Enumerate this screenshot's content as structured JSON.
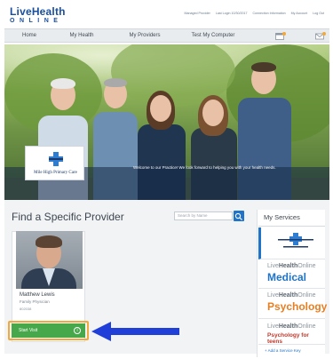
{
  "brand": {
    "line1_a": "Live",
    "line1_b": "Health",
    "line2": "ONLINE"
  },
  "utility_links": [
    "Managed Provider",
    "Last Login 10/30/2017",
    "Connection Information",
    "My Account",
    "Log Out"
  ],
  "nav": {
    "home": "Home",
    "my_health": "My Health",
    "my_providers": "My Providers",
    "test_computer": "Test My Computer"
  },
  "hero": {
    "clinic_name": "Mile High Primary Care",
    "welcome_text": "Welcome to our Practice! We look forward to helping you with your health needs."
  },
  "find_provider": {
    "title": "Find a Specific Provider",
    "search_placeholder": "Search by Name"
  },
  "provider": {
    "name": "Matthew Lewis",
    "role": "Family Physician",
    "id": "802038",
    "start_visit_label": "Start Visit"
  },
  "services": {
    "title": "My Services",
    "items": [
      {
        "brand_a": "Live",
        "brand_b": "Health",
        "brand_c": "Online",
        "name": "Medical",
        "color": "#1f73c8"
      },
      {
        "brand_a": "Live",
        "brand_b": "Health",
        "brand_c": "Online",
        "name": "Psychology",
        "color": "#e67e22"
      },
      {
        "brand_a": "Live",
        "brand_b": "Health",
        "brand_c": "Online",
        "name": "Psychology for teens",
        "color": "#c0392b"
      }
    ],
    "add_label": "Add a Service Key"
  },
  "colors": {
    "brand_blue": "#1a4fa0",
    "start_green": "#46a84a",
    "highlight_orange": "#f2a93b",
    "arrow_blue": "#1f3fd8"
  }
}
